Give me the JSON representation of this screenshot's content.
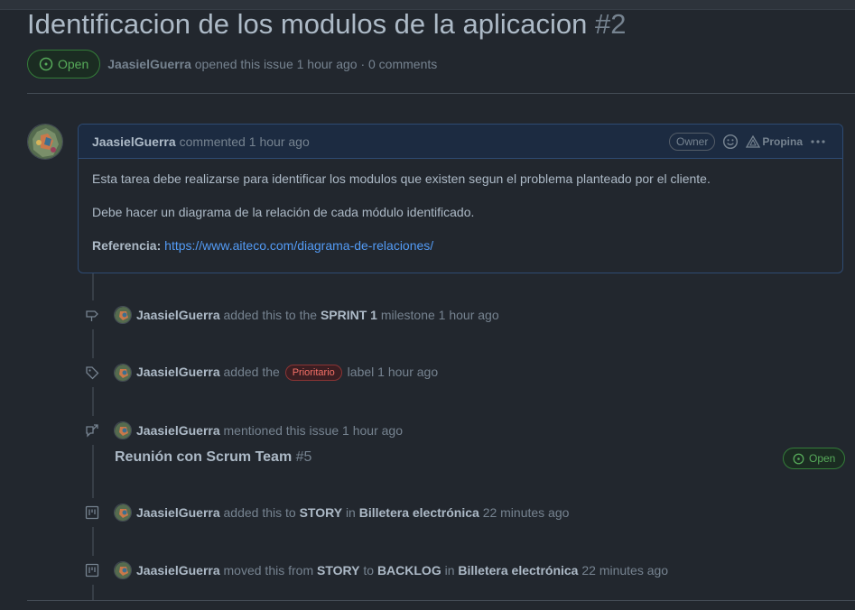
{
  "issue": {
    "title": "Identificacion de los modulos de la aplicacion",
    "number": "#2",
    "state": "Open",
    "author": "JaasielGuerra",
    "opened_text": "opened this issue 1 hour ago · 0 comments"
  },
  "comment": {
    "author": "JaasielGuerra",
    "action": "commented",
    "time": "1 hour ago",
    "owner_badge": "Owner",
    "tip_label": "Propina",
    "paragraph1": "Esta tarea debe realizarse para identificar los modulos que existen segun el problema planteado por el cliente.",
    "paragraph2": "Debe hacer un diagrama de la relación de cada módulo identificado.",
    "ref_label": "Referencia:",
    "ref_link": "https://www.aiteco.com/diagrama-de-relaciones/"
  },
  "timeline": {
    "milestone": {
      "actor": "JaasielGuerra",
      "text_before": "added this to the",
      "milestone_name": "SPRINT 1",
      "text_after": "milestone",
      "time": "1 hour ago"
    },
    "label_event": {
      "actor": "JaasielGuerra",
      "text_before": "added the",
      "label_name": "Prioritario",
      "label_color": "#f47067",
      "text_after": "label",
      "time": "1 hour ago"
    },
    "mention": {
      "actor": "JaasielGuerra",
      "text": "mentioned this issue",
      "time": "1 hour ago",
      "ref_title": "Reunión con Scrum Team",
      "ref_number": "#5",
      "ref_state": "Open"
    },
    "project_add": {
      "actor": "JaasielGuerra",
      "text_before": "added this to",
      "column": "STORY",
      "text_in": "in",
      "project": "Billetera electrónica",
      "time": "22 minutes ago"
    },
    "project_move": {
      "actor": "JaasielGuerra",
      "text_before": "moved this from",
      "from_column": "STORY",
      "text_to": "to",
      "to_column": "BACKLOG",
      "text_in": "in",
      "project": "Billetera electrónica",
      "time": "22 minutes ago"
    }
  },
  "colors": {
    "background": "#22272e",
    "open_green": "#57ab5a",
    "link_blue": "#539bf5",
    "comment_border": "#2e4b73"
  }
}
